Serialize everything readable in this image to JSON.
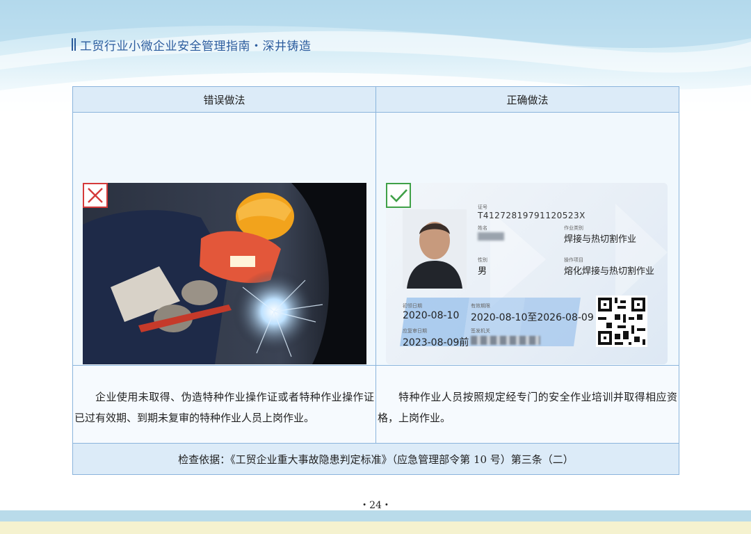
{
  "header": {
    "title": "工贸行业小微企业安全管理指南・深井铸造"
  },
  "table": {
    "headers": {
      "wrong": "错误做法",
      "correct": "正确做法"
    },
    "wrong": {
      "mark_icon": "cross-mark-icon",
      "mark_color": "#d53a3a",
      "description": "企业使用未取得、伪造特种作业操作证或者特种作业操作证已过有效期、到期未复审的特种作业人员上岗作业。"
    },
    "correct": {
      "mark_icon": "check-mark-icon",
      "mark_color": "#3fa047",
      "description": "特种作业人员按照规定经专门的安全作业培训并取得相应资格，上岗作业。",
      "card": {
        "cert_no_label": "证号",
        "cert_no": "T41272819791120523X",
        "name_label": "姓名",
        "type_label": "作业类别",
        "type_value": "焊接与热切割作业",
        "gender_label": "性别",
        "gender_value": "男",
        "item_label": "操作项目",
        "item_value": "熔化焊接与热切割作业",
        "first_issue_label": "初领日期",
        "first_issue_value": "2020-08-10",
        "valid_label": "有效期限",
        "valid_value": "2020-08-10至2026-08-09",
        "review_label": "应复审日期",
        "review_value": "2023-08-09前",
        "issuer_label": "签发机关"
      }
    },
    "basis": "检查依据：《工贸企业重大事故隐患判定标准》（应急管理部令第 10 号）第三条（二）"
  },
  "footer": {
    "page": "・24・"
  }
}
